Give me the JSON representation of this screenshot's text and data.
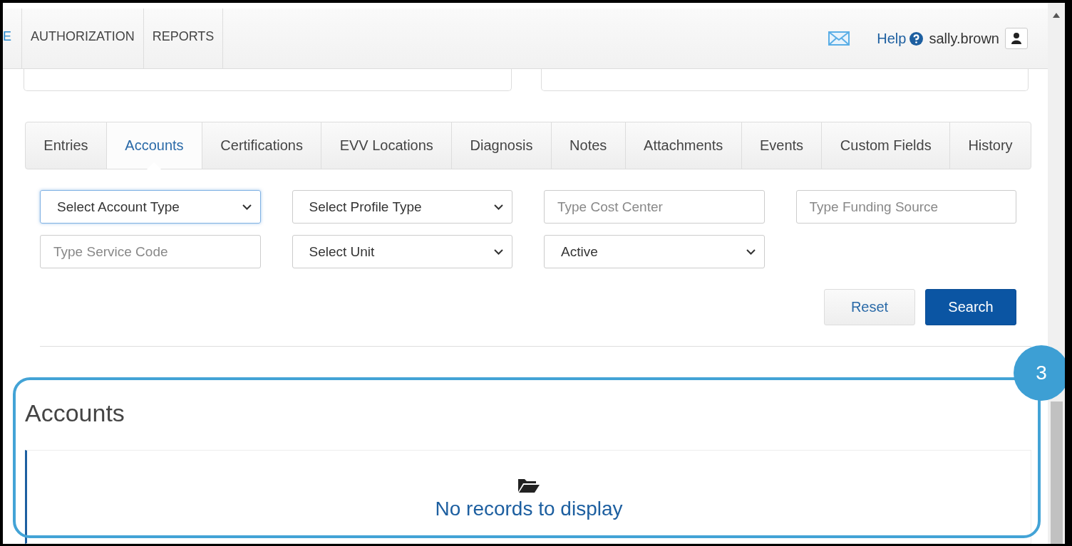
{
  "nav": {
    "items": [
      {
        "label": "E",
        "cut": true
      },
      {
        "label": "AUTHORIZATION",
        "cut": false
      },
      {
        "label": "REPORTS",
        "cut": false
      }
    ],
    "help": "Help",
    "user": "sally.brown"
  },
  "tabs": [
    {
      "label": "Entries",
      "selected": false
    },
    {
      "label": "Accounts",
      "selected": true
    },
    {
      "label": "Certifications",
      "selected": false
    },
    {
      "label": "EVV Locations",
      "selected": false
    },
    {
      "label": "Diagnosis",
      "selected": false
    },
    {
      "label": "Notes",
      "selected": false
    },
    {
      "label": "Attachments",
      "selected": false
    },
    {
      "label": "Events",
      "selected": false
    },
    {
      "label": "Custom Fields",
      "selected": false
    },
    {
      "label": "History",
      "selected": false
    }
  ],
  "filters": [
    {
      "kind": "select",
      "value": "Select Account Type",
      "focused": true
    },
    {
      "kind": "select",
      "value": "Select Profile Type",
      "focused": false
    },
    {
      "kind": "input",
      "placeholder": "Type Cost Center",
      "focused": false
    },
    {
      "kind": "input",
      "placeholder": "Type Funding Source",
      "focused": false
    },
    {
      "kind": "input",
      "placeholder": "Type Service Code",
      "focused": false
    },
    {
      "kind": "select",
      "value": "Select Unit",
      "focused": false
    },
    {
      "kind": "select",
      "value": "Active",
      "focused": false
    }
  ],
  "buttons": [
    {
      "label": "Reset",
      "kind": "default"
    },
    {
      "label": "Search",
      "kind": "primary"
    }
  ],
  "section": {
    "title": "Accounts",
    "empty_message": "No records to display"
  },
  "annotation": {
    "badge": "3"
  }
}
